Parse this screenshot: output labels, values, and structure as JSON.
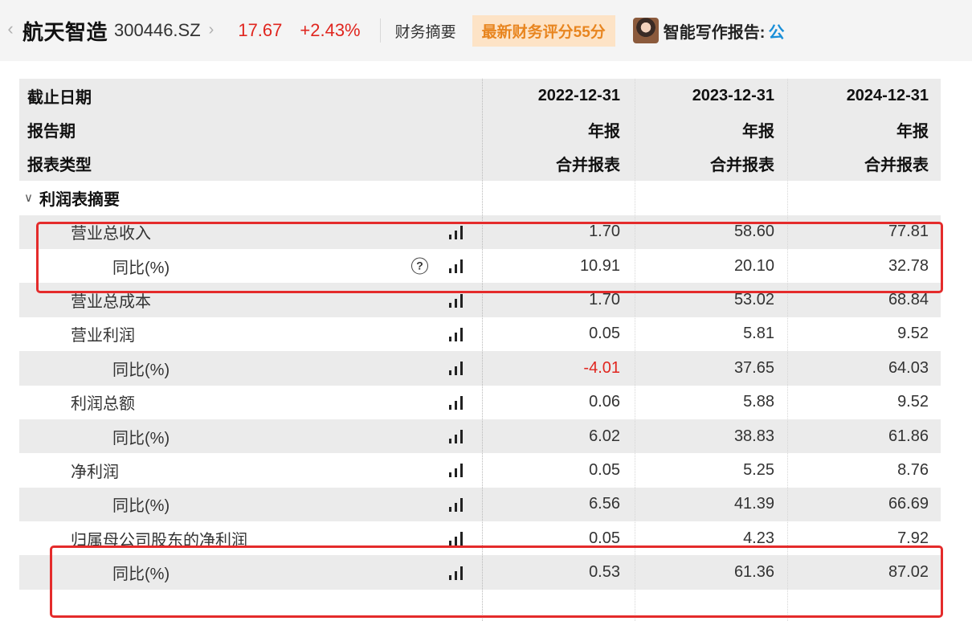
{
  "header": {
    "stock_name": "航天智造",
    "stock_code": "300446.SZ",
    "price": "17.67",
    "change_pct": "+2.43%",
    "summary_link": "财务摘要",
    "score_badge": "最新财务评分55分",
    "ai_report_label": "智能写作报告:",
    "ai_report_tail": "公",
    "back_icon": "chevron-left-icon",
    "forward_icon": "chevron-right-icon",
    "avatar_icon": "avatar-icon"
  },
  "colors": {
    "up_red": "#e0261f",
    "badge_orange": "#e8851f",
    "badge_bg": "#fde3c6",
    "highlight_red": "#e42b2b",
    "row_shade": "#ebebeb"
  },
  "table": {
    "header_rows": [
      {
        "label": "截止日期",
        "values": [
          "2022-12-31",
          "2023-12-31",
          "2024-12-31"
        ]
      },
      {
        "label": "报告期",
        "values": [
          "年报",
          "年报",
          "年报"
        ]
      },
      {
        "label": "报表类型",
        "values": [
          "合并报表",
          "合并报表",
          "合并报表"
        ]
      }
    ],
    "section": {
      "label": "利润表摘要",
      "icon": "chevron-down-icon"
    },
    "rows": [
      {
        "label": "营业总收入",
        "values": [
          "1.70",
          "58.60",
          "77.81"
        ]
      },
      {
        "label": "同比(%)",
        "values": [
          "10.91",
          "20.10",
          "32.78"
        ],
        "help": "?"
      },
      {
        "label": "营业总成本",
        "values": [
          "1.70",
          "53.02",
          "68.84"
        ]
      },
      {
        "label": "营业利润",
        "values": [
          "0.05",
          "5.81",
          "9.52"
        ]
      },
      {
        "label": "同比(%)",
        "values": [
          "-4.01",
          "37.65",
          "64.03"
        ]
      },
      {
        "label": "利润总额",
        "values": [
          "0.06",
          "5.88",
          "9.52"
        ]
      },
      {
        "label": "同比(%)",
        "values": [
          "6.02",
          "38.83",
          "61.86"
        ]
      },
      {
        "label": "净利润",
        "values": [
          "0.05",
          "5.25",
          "8.76"
        ]
      },
      {
        "label": "同比(%)",
        "values": [
          "6.56",
          "41.39",
          "66.69"
        ]
      },
      {
        "label": "归属母公司股东的净利润",
        "values": [
          "0.05",
          "4.23",
          "7.92"
        ]
      },
      {
        "label": "同比(%)",
        "values": [
          "0.53",
          "61.36",
          "87.02"
        ]
      }
    ],
    "row_icon": "bar-chart-icon"
  }
}
